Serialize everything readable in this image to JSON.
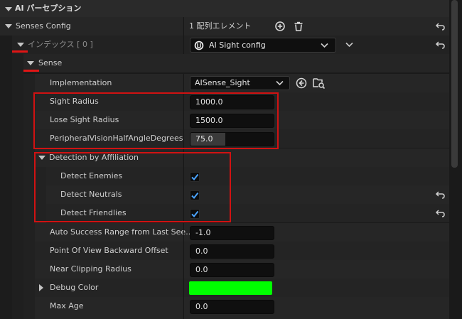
{
  "header": {
    "title": "AI パーセプション"
  },
  "senses_config": {
    "label": "Senses Config",
    "count_text": "1 配列エレメント"
  },
  "index_row": {
    "label": "インデックス [ 0 ]",
    "config_value": "AI Sight config"
  },
  "sense": {
    "label": "Sense"
  },
  "implementation": {
    "label": "Implementation",
    "value": "AISense_Sight"
  },
  "sight_radius": {
    "label": "Sight Radius",
    "value": "1000.0"
  },
  "lose_sight_radius": {
    "label": "Lose Sight Radius",
    "value": "1500.0"
  },
  "peripheral": {
    "label": "PeripheralVisionHalfAngleDegrees",
    "value": "75.0",
    "fill_fraction": 0.42
  },
  "detection": {
    "label": "Detection by Affiliation",
    "enemies": {
      "label": "Detect Enemies",
      "checked": true
    },
    "neutrals": {
      "label": "Detect Neutrals",
      "checked": true
    },
    "friendlies": {
      "label": "Detect Friendlies",
      "checked": true
    }
  },
  "auto_success": {
    "label": "Auto Success Range from Last See...",
    "value": "-1.0"
  },
  "pov_offset": {
    "label": "Point Of View Backward Offset",
    "value": "0.0"
  },
  "near_clip": {
    "label": "Near Clipping Radius",
    "value": "0.0"
  },
  "debug_color": {
    "label": "Debug Color",
    "color": "#00ff00"
  },
  "max_age": {
    "label": "Max Age",
    "value": "0.0"
  },
  "colors": {
    "highlight": "#d11212",
    "checkmark": "#4aa3ff",
    "debug": "#00ff00"
  }
}
